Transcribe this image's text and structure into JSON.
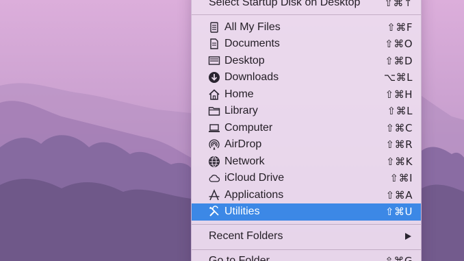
{
  "menu": {
    "top_item": {
      "label": "Select Startup Disk on Desktop",
      "shortcut": "⇧⌘↑"
    },
    "items": [
      {
        "label": "All My Files",
        "shortcut": "⇧⌘F",
        "icon": "all-my-files-icon"
      },
      {
        "label": "Documents",
        "shortcut": "⇧⌘O",
        "icon": "documents-icon"
      },
      {
        "label": "Desktop",
        "shortcut": "⇧⌘D",
        "icon": "desktop-icon"
      },
      {
        "label": "Downloads",
        "shortcut": "⌥⌘L",
        "icon": "downloads-icon"
      },
      {
        "label": "Home",
        "shortcut": "⇧⌘H",
        "icon": "home-icon"
      },
      {
        "label": "Library",
        "shortcut": "⇧⌘L",
        "icon": "folder-icon"
      },
      {
        "label": "Computer",
        "shortcut": "⇧⌘C",
        "icon": "computer-icon"
      },
      {
        "label": "AirDrop",
        "shortcut": "⇧⌘R",
        "icon": "airdrop-icon"
      },
      {
        "label": "Network",
        "shortcut": "⇧⌘K",
        "icon": "network-icon"
      },
      {
        "label": "iCloud Drive",
        "shortcut": "⇧⌘I",
        "icon": "cloud-icon"
      },
      {
        "label": "Applications",
        "shortcut": "⇧⌘A",
        "icon": "applications-icon"
      },
      {
        "label": "Utilities",
        "shortcut": "⇧⌘U",
        "icon": "utilities-icon",
        "selected": true
      }
    ],
    "recent_folders": {
      "label": "Recent Folders",
      "icon": "submenu-arrow-icon"
    },
    "go_to_folder": {
      "label": "Go to Folder...",
      "shortcut": "⇧⌘G"
    }
  },
  "colors": {
    "selection": "#3c88e6",
    "menu_background": "#ecdcee",
    "wallpaper": "#c79acb"
  }
}
